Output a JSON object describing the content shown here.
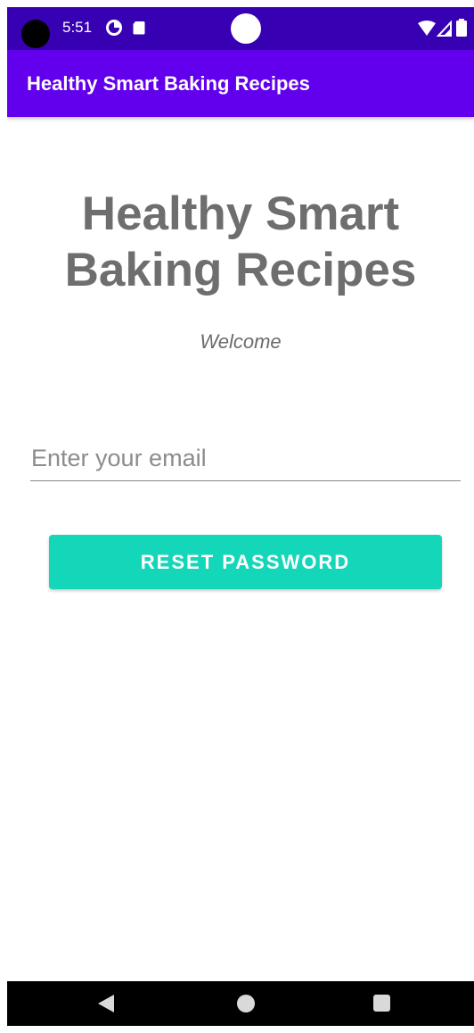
{
  "status_bar": {
    "time": "5:51",
    "icons": [
      "camera-cutout-icon",
      "data-saver-icon",
      "sd-card-icon",
      "wifi-icon",
      "signal-icon",
      "battery-icon"
    ],
    "color": "#3700b3"
  },
  "app_bar": {
    "title": "Healthy Smart Baking Recipes",
    "color": "#6200ee"
  },
  "main": {
    "title_line1": "Healthy Smart",
    "title_line2": "Baking Recipes",
    "subtitle": "Welcome",
    "email_placeholder": "Enter your email",
    "email_value": "",
    "reset_button_label": "RESET PASSWORD",
    "button_color": "#14d6b9"
  },
  "nav_bar": {
    "icons": [
      "back-icon",
      "home-icon",
      "recents-icon"
    ]
  }
}
